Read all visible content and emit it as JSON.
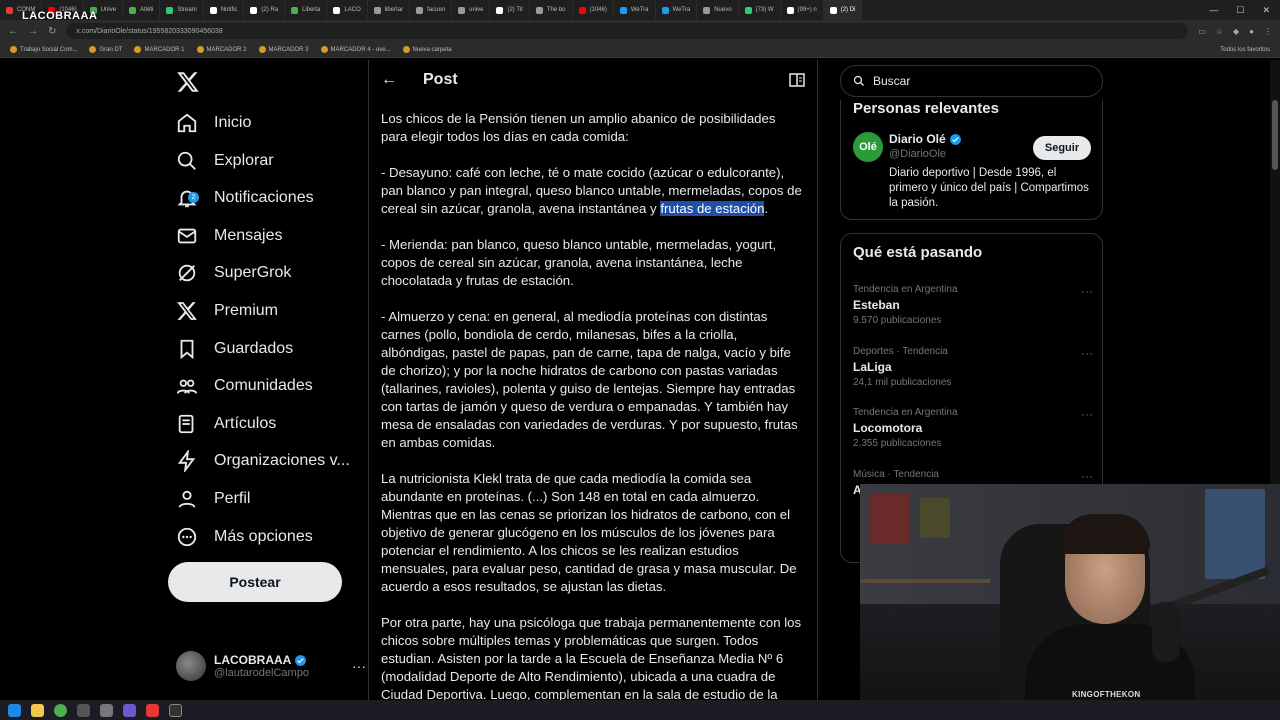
{
  "browser": {
    "tabs": [
      "CONM",
      "(1046)",
      "Unive",
      "Atléti",
      "Stream",
      "Notific",
      "(2) Ra",
      "Liberta",
      "LACO",
      "libertar",
      "facuen",
      "unive",
      "(2) Tit",
      "The bo",
      "(1046)",
      "WeTra",
      "WeTra",
      "Nuevo",
      "(73) W",
      "(99+) n",
      "(2) Di"
    ],
    "url": "x.com/DiarioOle/status/1955820333090456038",
    "bookmarks": [
      "Trabajo Social Com...",
      "Gran DT",
      "MARCADOR 1",
      "MARCADOR 2",
      "MARCADOR 3",
      "MARCADOR 4 - ove...",
      "Nueva carpeta"
    ],
    "bookmarks_right": "Todos los favoritos",
    "streamer_logo": "LACOBRAAA"
  },
  "nav": {
    "items": [
      {
        "label": "Inicio",
        "icon": "home-icon"
      },
      {
        "label": "Explorar",
        "icon": "search-icon"
      },
      {
        "label": "Notificaciones",
        "icon": "bell-icon",
        "badge": "2"
      },
      {
        "label": "Mensajes",
        "icon": "mail-icon"
      },
      {
        "label": "SuperGrok",
        "icon": "grok-icon"
      },
      {
        "label": "Premium",
        "icon": "x-icon"
      },
      {
        "label": "Guardados",
        "icon": "bookmark-icon"
      },
      {
        "label": "Comunidades",
        "icon": "people-icon"
      },
      {
        "label": "Artículos",
        "icon": "article-icon"
      },
      {
        "label": "Organizaciones v...",
        "icon": "lightning-icon"
      },
      {
        "label": "Perfil",
        "icon": "person-icon"
      },
      {
        "label": "Más opciones",
        "icon": "more-circle-icon"
      }
    ],
    "post_button": "Postear",
    "account": {
      "name": "LACOBRAAA",
      "handle": "@lautarodelCampo"
    }
  },
  "post": {
    "header_title": "Post",
    "paragraphs": [
      "Los chicos de la Pensión tienen un amplio abanico de posibilidades para elegir todos los días en cada comida:",
      "- Merienda: pan blanco, queso blanco untable, mermeladas, yogurt, copos de cereal sin azúcar, granola, avena instantánea, leche chocolatada y frutas de estación.",
      "- Almuerzo y cena: en general, al mediodía proteínas con distintas carnes (pollo, bondiola de cerdo, milanesas, bifes a la criolla, albóndigas, pastel de papas, pan de carne, tapa de nalga, vacío y bife de chorizo); y por la noche hidratos de carbono con pastas variadas (tallarines, ravioles), polenta y guiso de lentejas. Siempre hay entradas con tartas de jamón y queso de verdura o empanadas. Y también hay mesa de ensaladas con variedades de verduras. Y por supuesto, frutas en ambas comidas.",
      "La nutricionista Klekl trata de que cada mediodía la comida sea abundante en proteínas. (...) Son 148 en total en cada almuerzo. Mientras que en las cenas se priorizan los hidratos de carbono, con el objetivo de generar glucógeno en los músculos de los jóvenes para potenciar el rendimiento. A los chicos se les realizan estudios mensuales, para evaluar peso, cantidad de grasa y masa muscular. De acuerdo a esos resultados, se ajustan las dietas.",
      "Por otra parte, hay una psicóloga que trabaja permanentemente con los chicos sobre múltiples temas y problemáticas que surgen. Todos estudian. Asisten por la tarde a la Escuela de Enseñanza Media Nº 6 (modalidad Deporte de Alto Rendimiento), ubicada a una cuadra de Ciudad Deportiva. Luego, complementan en la sala de estudio de la"
    ],
    "breakfast_pre": "- Desayuno: café con leche, té o mate cocido (azúcar o edulcorante), pan blanco y pan integral, queso blanco untable, mermeladas, copos de cereal sin azúcar, granola, avena instantánea y ",
    "breakfast_highlight": "frutas de estación",
    "breakfast_post": "."
  },
  "sidebar": {
    "search_placeholder": "Buscar",
    "relevant_title": "Personas relevantes",
    "relevant": {
      "logo_text": "Olé",
      "name": "Diario Olé",
      "handle": "@DiarioOle",
      "follow": "Seguir",
      "bio": "Diario deportivo | Desde 1996, el primero y único del país | Compartimos la pasión."
    },
    "trending_title": "Qué está pasando",
    "trends": [
      {
        "category": "Tendencia en Argentina",
        "name": "Esteban",
        "count": "9.570 publicaciones"
      },
      {
        "category": "Deportes · Tendencia",
        "name": "LaLiga",
        "count": "24,1 mil publicaciones"
      },
      {
        "category": "Tendencia en Argentina",
        "name": "Locomotora",
        "count": "2.355 publicaciones"
      },
      {
        "category": "Música · Tendencia",
        "name": "Angela Aguilar",
        "count": ""
      }
    ]
  },
  "webcam": {
    "hoodie_text": "KINGOFTHEKON"
  },
  "colors": {
    "accent": "#1d9bf0",
    "highlight": "#1f4fa8",
    "ole_green": "#2b9a3a"
  }
}
